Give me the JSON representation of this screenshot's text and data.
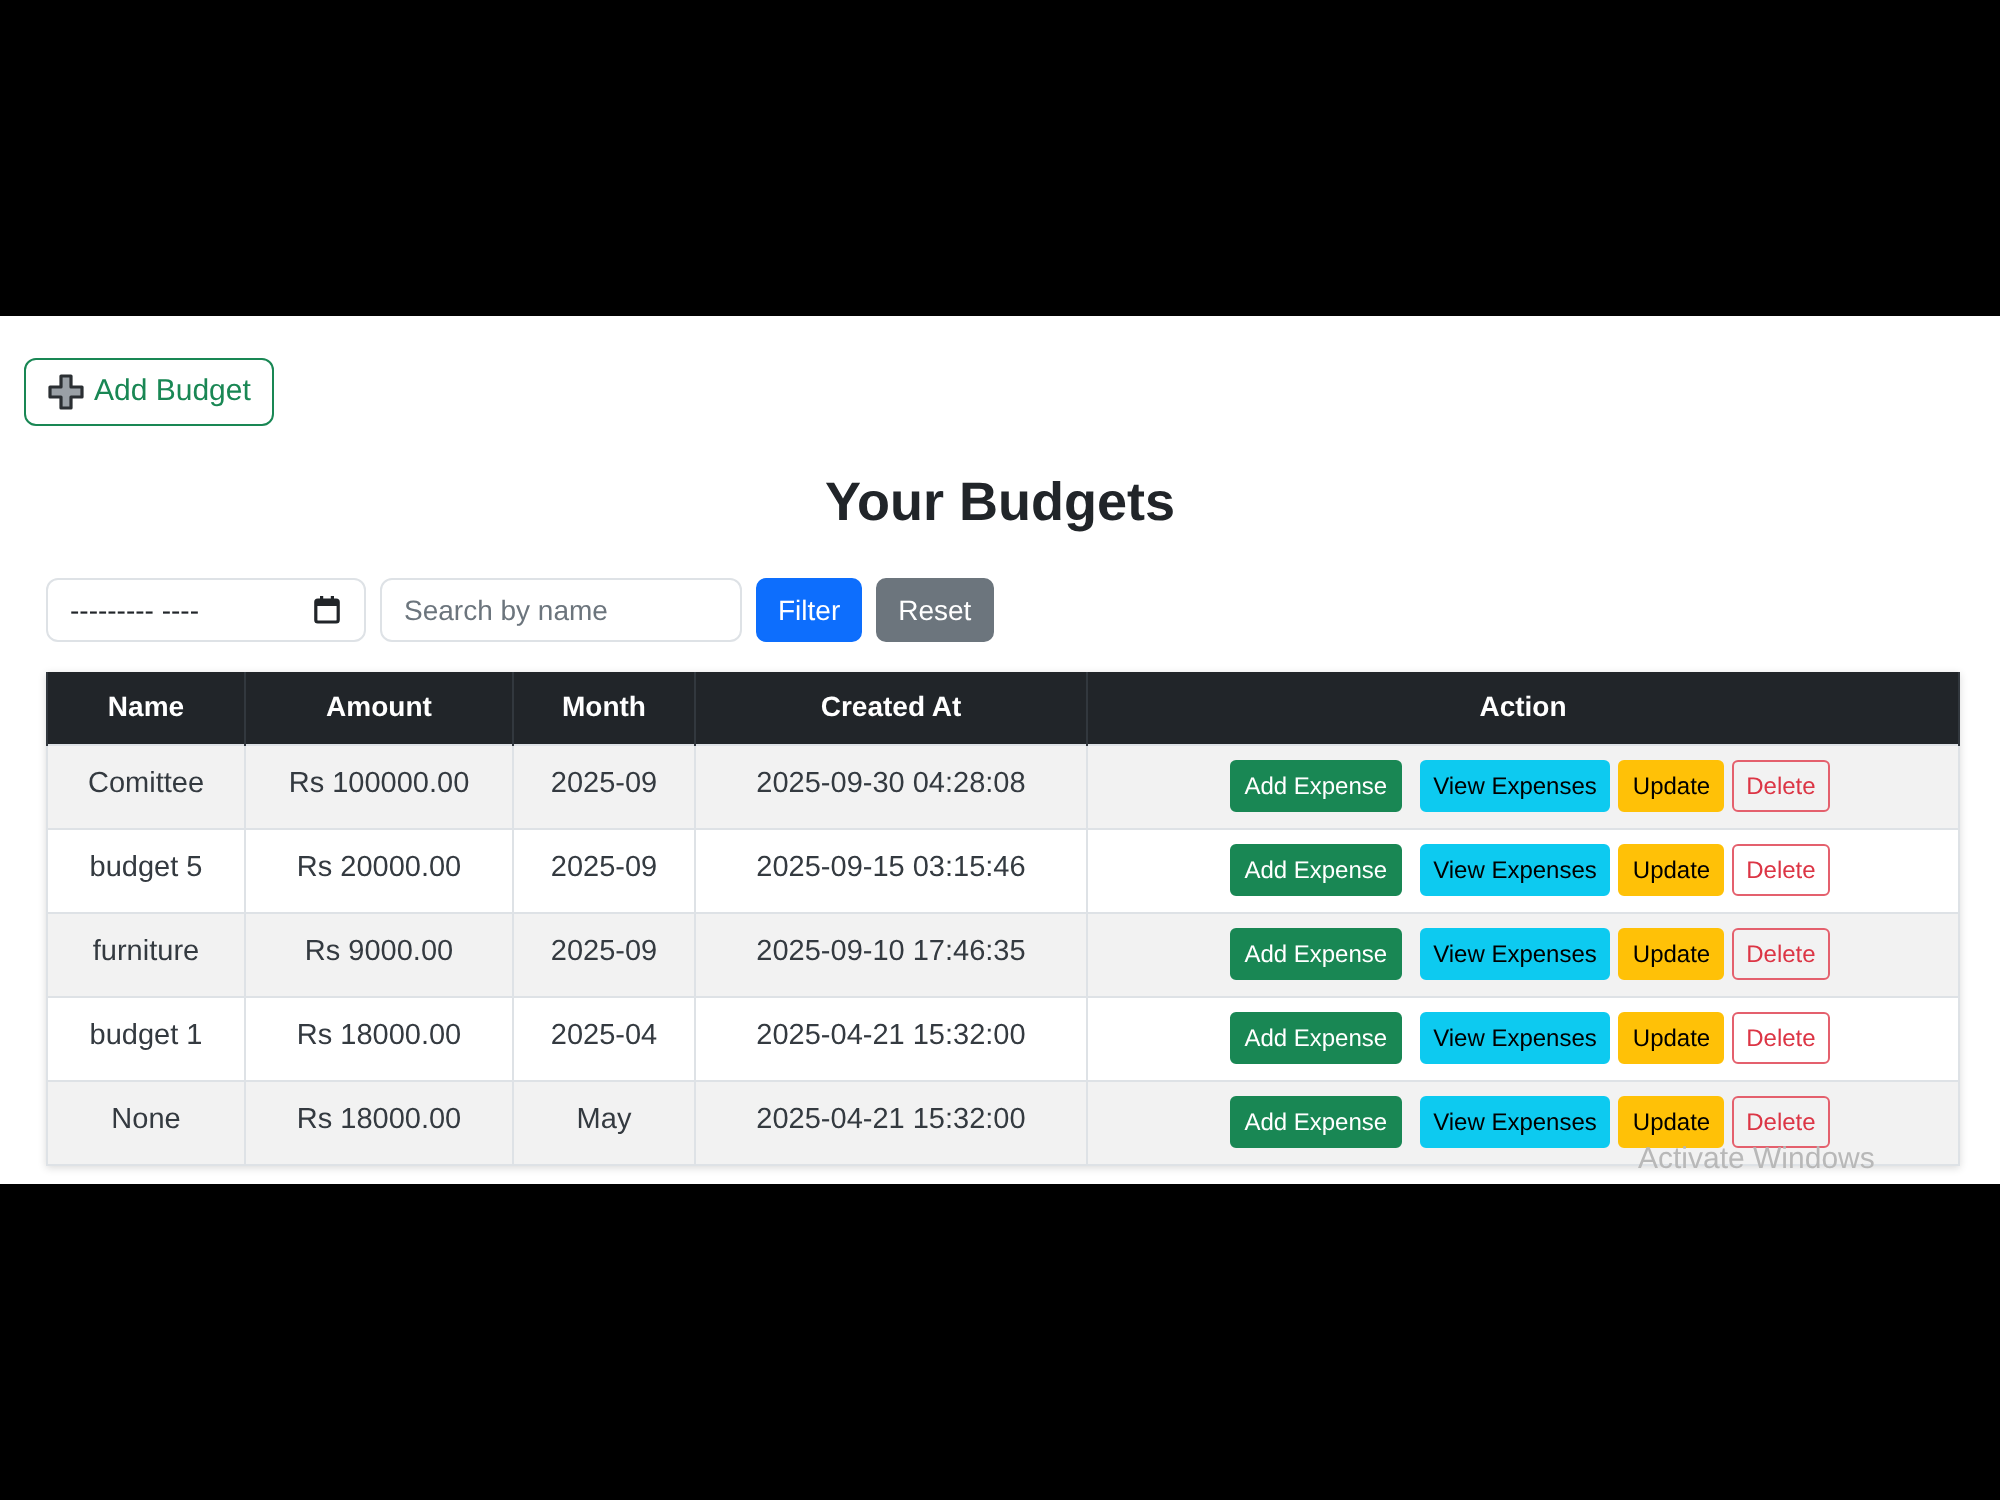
{
  "add_budget_button": {
    "label": "Add Budget"
  },
  "title": "Your Budgets",
  "filters": {
    "month_field": {
      "placeholder": "--------- ----"
    },
    "search_field": {
      "placeholder": "Search by name"
    },
    "buttons": [
      {
        "label": "Filter",
        "kind": "primary"
      },
      {
        "label": "Reset",
        "kind": "secondary"
      }
    ]
  },
  "table": {
    "columns": [
      "Name",
      "Amount",
      "Month",
      "Created At",
      "Action"
    ],
    "rows": [
      {
        "cells": [
          "Comittee",
          "Rs 100000.00",
          "2025-09",
          "2025-09-30 04:28:08"
        ],
        "actions": [
          {
            "label": "Add Expense",
            "kind": "success"
          },
          {
            "label": "View Expenses",
            "kind": "info"
          },
          {
            "label": "Update",
            "kind": "warning"
          },
          {
            "label": "Delete",
            "kind": "danger-outline"
          }
        ]
      },
      {
        "cells": [
          "budget 5",
          "Rs 20000.00",
          "2025-09",
          "2025-09-15 03:15:46"
        ],
        "actions": [
          {
            "label": "Add Expense",
            "kind": "success"
          },
          {
            "label": "View Expenses",
            "kind": "info"
          },
          {
            "label": "Update",
            "kind": "warning"
          },
          {
            "label": "Delete",
            "kind": "danger-outline"
          }
        ]
      },
      {
        "cells": [
          "furniture",
          "Rs 9000.00",
          "2025-09",
          "2025-09-10 17:46:35"
        ],
        "actions": [
          {
            "label": "Add Expense",
            "kind": "success"
          },
          {
            "label": "View Expenses",
            "kind": "info"
          },
          {
            "label": "Update",
            "kind": "warning"
          },
          {
            "label": "Delete",
            "kind": "danger-outline"
          }
        ]
      },
      {
        "cells": [
          "budget 1",
          "Rs 18000.00",
          "2025-04",
          "2025-04-21 15:32:00"
        ],
        "actions": [
          {
            "label": "Add Expense",
            "kind": "success"
          },
          {
            "label": "View Expenses",
            "kind": "info"
          },
          {
            "label": "Update",
            "kind": "warning"
          },
          {
            "label": "Delete",
            "kind": "danger-outline"
          }
        ]
      },
      {
        "cells": [
          "None",
          "Rs 18000.00",
          "May",
          "2025-04-21 15:32:00"
        ],
        "actions": [
          {
            "label": "Add Expense",
            "kind": "success"
          },
          {
            "label": "View Expenses",
            "kind": "info"
          },
          {
            "label": "Update",
            "kind": "warning"
          },
          {
            "label": "Delete",
            "kind": "danger-outline"
          }
        ]
      }
    ]
  },
  "os_watermark": "Activate Windows"
}
